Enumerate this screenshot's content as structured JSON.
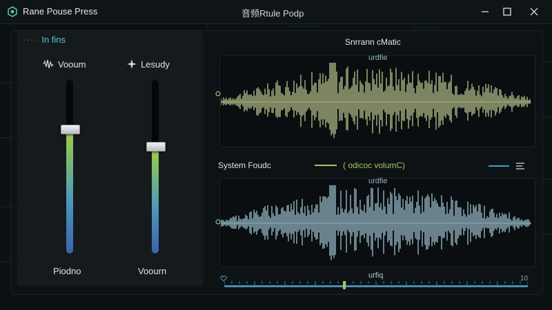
{
  "window": {
    "title": "Rane Pouse Press",
    "center_title": "音频Rtule Podp"
  },
  "left_panel": {
    "section_title": "In fins",
    "sliders": [
      {
        "top_label": "Vooum",
        "bottom_label": "Piodno",
        "level": 0.72
      },
      {
        "top_label": "Lesudy",
        "bottom_label": "Voourn",
        "level": 0.62
      }
    ]
  },
  "waveforms": {
    "header": "Snrrann cMatic",
    "top": {
      "sublabel": "urdfie",
      "color": "#c9d39a"
    },
    "legend": {
      "left_text": "System Foudc",
      "series_text": "( odicoc volumC)",
      "series_color": "#a6c95a",
      "line2_color": "#4a9cc8"
    },
    "bottom": {
      "sublabel": "urdfie",
      "color": "#a9cfe0"
    },
    "timeline": {
      "label": "urfiq",
      "end": "10"
    }
  }
}
